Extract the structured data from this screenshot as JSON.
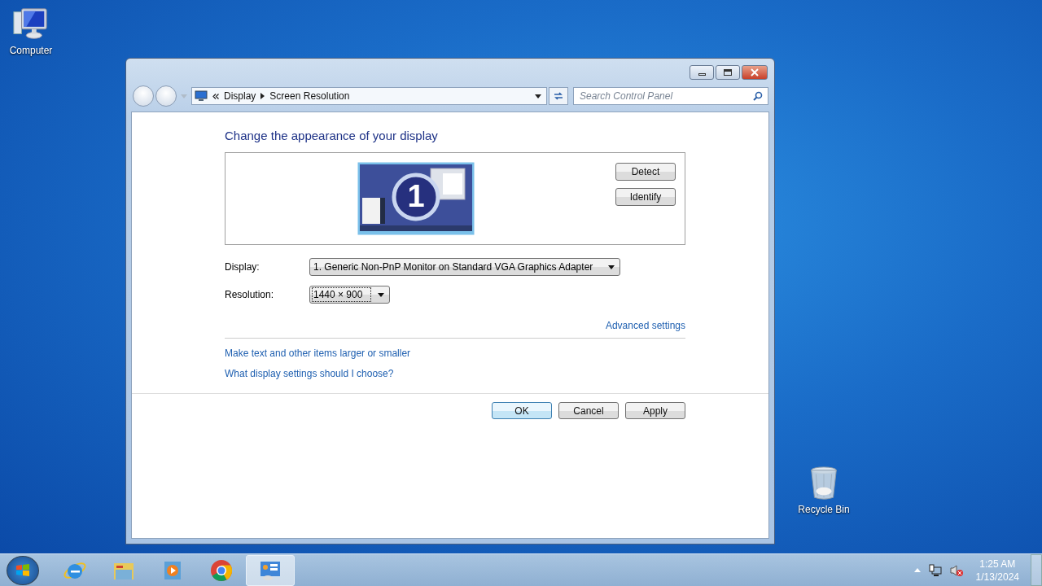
{
  "desktop_icons": [
    {
      "label": "Computer",
      "kind": "computer"
    },
    {
      "label": "Recycle Bin",
      "kind": "recycle"
    }
  ],
  "window": {
    "breadcrumb": [
      "Display",
      "Screen Resolution"
    ],
    "search": {
      "placeholder": "Search Control Panel"
    },
    "heading": "Change the appearance of your display",
    "monitor_number": "1",
    "side_buttons": [
      "Detect",
      "Identify"
    ],
    "fields": [
      {
        "label": "Display:",
        "value": "1. Generic Non-PnP Monitor on Standard VGA Graphics Adapter",
        "focused": false
      },
      {
        "label": "Resolution:",
        "value": "1440 × 900",
        "focused": true
      }
    ],
    "advanced_link": "Advanced settings",
    "links": [
      "Make text and other items larger or smaller",
      "What display settings should I choose?"
    ],
    "buttons": [
      {
        "label": "OK",
        "default": true
      },
      {
        "label": "Cancel",
        "default": false
      },
      {
        "label": "Apply",
        "default": false
      }
    ]
  },
  "taskbar": {
    "apps": [
      {
        "kind": "ie",
        "selected": false
      },
      {
        "kind": "explorer",
        "selected": false
      },
      {
        "kind": "media",
        "selected": false
      },
      {
        "kind": "chrome",
        "selected": false
      },
      {
        "kind": "control",
        "selected": true
      }
    ],
    "clock": {
      "time": "1:25 AM",
      "date": "1/13/2024"
    }
  }
}
